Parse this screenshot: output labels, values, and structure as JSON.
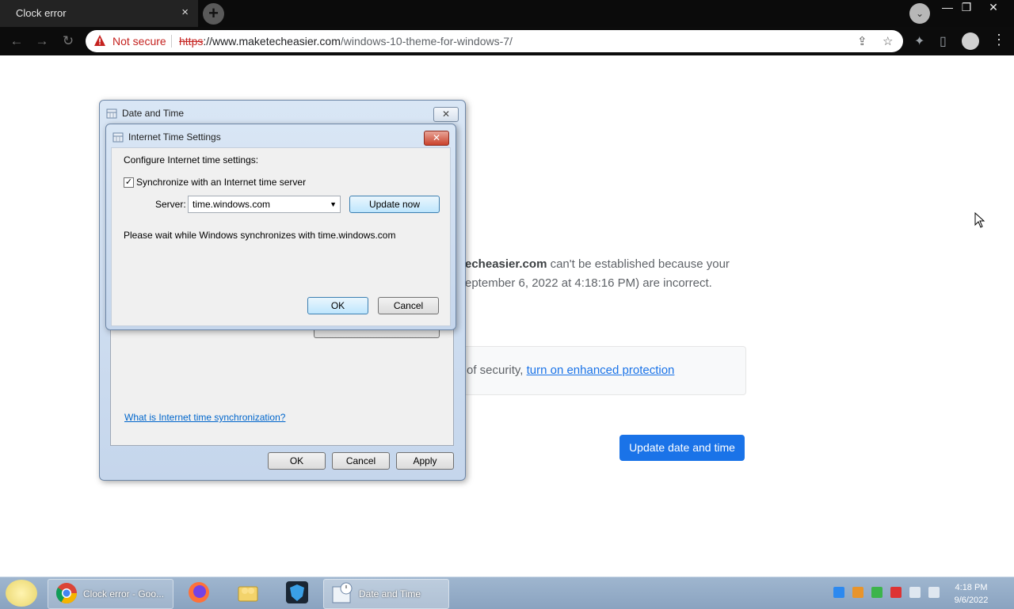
{
  "browser": {
    "tab_title": "Clock error",
    "tab_close": "×",
    "new_tab": "+",
    "security_label": "Not secure",
    "url_scheme": "https",
    "url_host": "://www.maketecheasier.com",
    "url_path": "/windows-10-theme-for-windows-7/"
  },
  "page": {
    "line1_host": "echeasier.com",
    "line1_rest": " can't be established because your",
    "line2": "eptember 6, 2022 at 4:18:16 PM) are incorrect.",
    "security_text": "of security, ",
    "security_link": "turn on enhanced protection",
    "update_button": "Update date and time"
  },
  "date_time_dialog": {
    "title": "Date and Time",
    "link": "What is Internet time synchronization?",
    "ok": "OK",
    "cancel": "Cancel",
    "apply": "Apply"
  },
  "internet_time_dialog": {
    "title": "Internet Time Settings",
    "heading": "Configure Internet time settings:",
    "sync_label": "Synchronize with an Internet time server",
    "sync_checked": true,
    "server_label": "Server:",
    "server_value": "time.windows.com",
    "update_now": "Update now",
    "status": "Please wait while Windows synchronizes with time.windows.com",
    "ok": "OK",
    "cancel": "Cancel"
  },
  "taskbar": {
    "chrome_item": "Clock error - Goo...",
    "datetime_item": "Date and Time",
    "time": "4:18 PM",
    "date": "9/6/2022"
  }
}
